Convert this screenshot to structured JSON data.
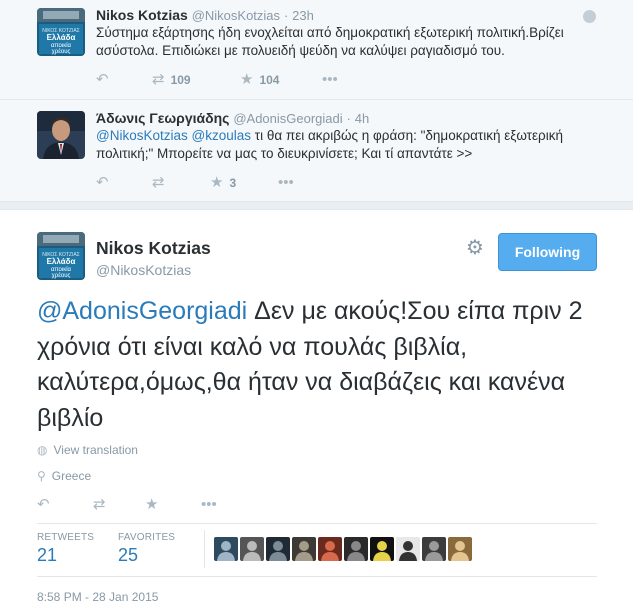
{
  "tweets": [
    {
      "name": "Nikos Kotzias",
      "handle": "@NikosKotzias",
      "dot": "·",
      "time": "23h",
      "text_line1": "Σύστημα εξάρτησης ήδη ενοχλείται από δημοκρατική εξωτερική πολιτική.Βρίζει",
      "text_line2": "ασύστολα. Επιδιώκει με πολυειδή ψεύδη να καλύψει ραγιαδισμό του.",
      "retweets": "109",
      "favorites": "104",
      "avatar_text": [
        "ΝΙΚΟΣ ΚΟΤΖΙΑΣ",
        "Ελλάδα",
        "αποικία",
        "χρέους"
      ]
    },
    {
      "name": "Άδωνις Γεωργιάδης",
      "handle": "@AdonisGeorgiadi",
      "dot": "·",
      "time": "4h",
      "mention1": "@NikosKotzias",
      "mention2": "@kzoulas",
      "text_line1": " τι θα πει ακριβώς η φράση: \"δημοκρατική εξωτερική",
      "text_line2": "πολιτική;\" Μπορείτε να μας το διευκρινίσετε; Και τί απαντάτε >>",
      "retweets": "",
      "favorites": "3"
    }
  ],
  "main": {
    "name": "Nikos Kotzias",
    "handle": "@NikosKotzias",
    "follow_label": "Following",
    "mention": "@AdonisGeorgiadi",
    "text": " Δεν με ακούς!Σου είπα πριν 2 χρόνια ότι είναι καλό να πουλάς βιβλία, καλύτερα,όμως,θα ήταν να διαβάζεις και κανένα βιβλίο",
    "view_translation": "View translation",
    "location": "Greece",
    "retweets_label": "RETWEETS",
    "retweets_count": "21",
    "favorites_label": "FAVORITES",
    "favorites_count": "25",
    "timestamp": "8:58 PM - 28 Jan 2015",
    "avatar_text": [
      "ΝΙΚΟΣ ΚΟΤΖΙΑΣ",
      "Ελλάδα",
      "αποικία",
      "χρέους"
    ],
    "favoriters": [
      {
        "bg": "#2e4a5f",
        "fg": "#9fb4c4"
      },
      {
        "bg": "#555555",
        "fg": "#bbbbbb"
      },
      {
        "bg": "#1f2a35",
        "fg": "#7d8b97"
      },
      {
        "bg": "#3d3a35",
        "fg": "#a49b8a"
      },
      {
        "bg": "#6b2a1e",
        "fg": "#d86a4c"
      },
      {
        "bg": "#2a2a2a",
        "fg": "#888888"
      },
      {
        "bg": "#111111",
        "fg": "#e6d24a"
      },
      {
        "bg": "#e8e8e8",
        "fg": "#333333"
      },
      {
        "bg": "#3c3c3c",
        "fg": "#9a9a9a"
      },
      {
        "bg": "#8a6a3c",
        "fg": "#e3c58f"
      }
    ]
  },
  "icons": {
    "reply": "reply-icon",
    "retweet": "retweet-icon",
    "favorite": "star-icon",
    "more": "more-icon",
    "gear": "gear-icon",
    "globe": "globe-icon",
    "location": "location-pin-icon"
  },
  "colors": {
    "link": "#2b7bb9",
    "button": "#55acee",
    "muted": "#8899a6",
    "bg_conversation": "#f5f8fa"
  }
}
